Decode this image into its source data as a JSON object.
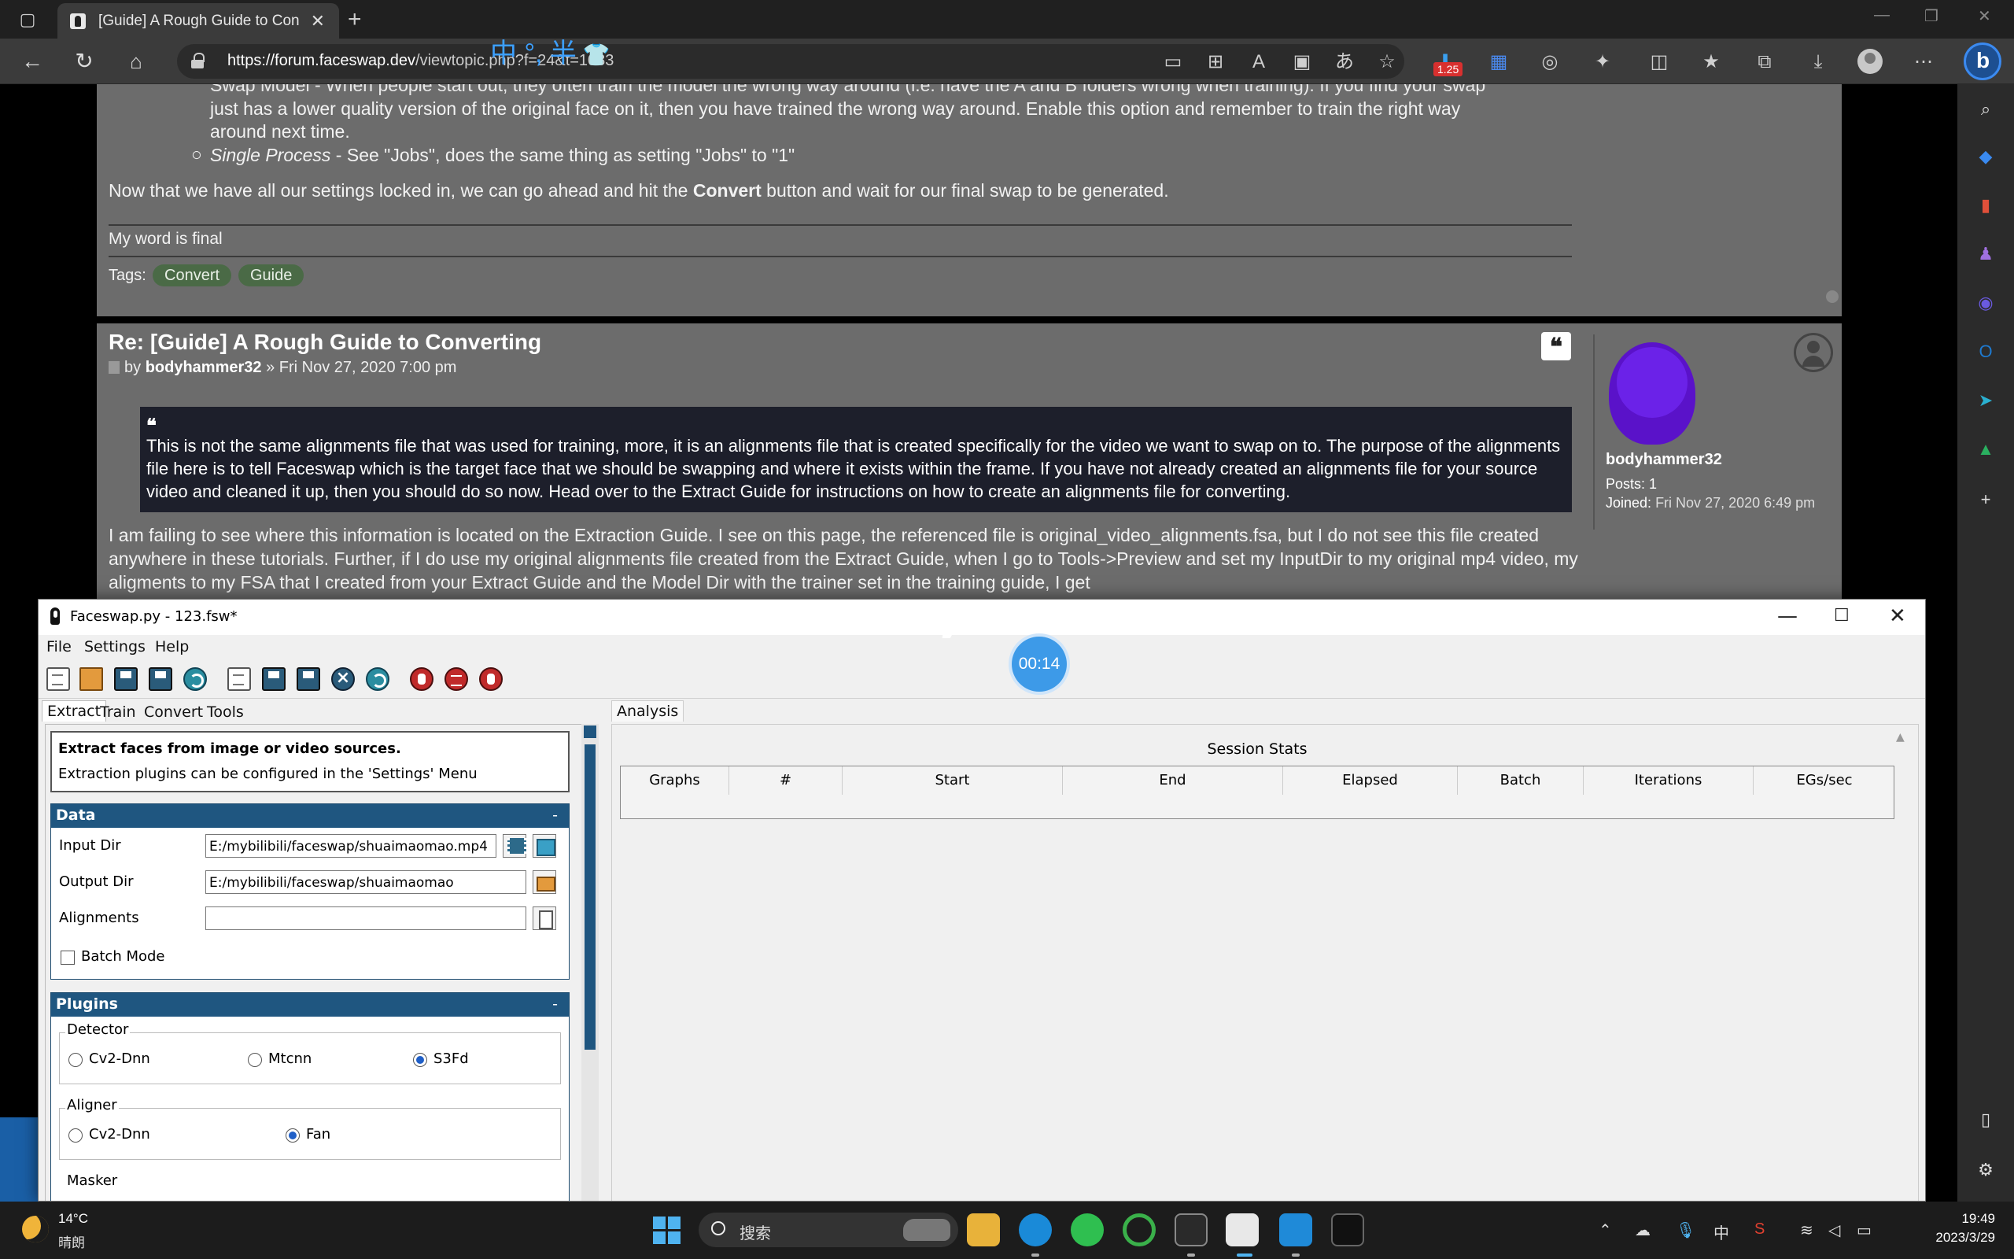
{
  "browser": {
    "tab_title": "[Guide] A Rough Guide to Converting",
    "url_host": "https://forum.faceswap.dev",
    "url_path": "/viewtopic.php?f=24&t=1083",
    "ime_overlay": "中 °, 半",
    "download_badge": "1.25"
  },
  "post1": {
    "line1": "Swap Model - When people start out, they often train the model the wrong way around (i.e. have the A and B folders wrong when training). If you find your swap",
    "line2": "just has a lower quality version of the original face on it, then you have trained the wrong way around. Enable this option and remember to train the right way",
    "line3": "around next time.",
    "single_process_label": "Single Process",
    "single_process_text": " - See \"Jobs\", does the same thing as setting \"Jobs\" to \"1\"",
    "final_pre": "Now that we have all our settings locked in, we can go ahead and hit the ",
    "final_bold": "Convert",
    "final_post": " button and wait for our final swap to be generated.",
    "signature": "My word is final",
    "tags_label": "Tags:",
    "tags": [
      "Convert",
      "Guide"
    ]
  },
  "post2": {
    "title": "Re: [Guide] A Rough Guide to Converting",
    "by": "by",
    "author": "bodyhammer32",
    "date": "» Fri Nov 27, 2020 7:00 pm",
    "quote_mark": "❝",
    "quote": "This is not the same alignments file that was used for training, more, it is an alignments file that is created specifically for the video we want to swap on to. The purpose of the alignments file here is to tell Faceswap which is the target face that we should be swapping and where it exists within the frame. If you have not already created an alignments file for your source video and cleaned it up, then you should do so now. Head over to the Extract Guide for instructions on how to create an alignments file for converting.",
    "body": "I am failing to see where this information is located on the Extraction Guide. I see on this page, the referenced file is original_video_alignments.fsa, but I do not see this file created anywhere in these tutorials. Further, if I do use my original alignments file created from the Extract Guide, when I go to Tools->Preview and set my InputDir to my original mp4 video, my aligments to my FSA that I created from your Extract Guide and the Model Dir with the trainer set in the training guide, I get",
    "profile_name": "bodyhammer32",
    "posts_label": "Posts:",
    "posts_value": "1",
    "joined_label": "Joined:",
    "joined_value": "Fri Nov 27, 2020 6:49 pm"
  },
  "faceswap": {
    "title": "Faceswap.py - 123.fsw*",
    "menu": [
      "File",
      "Settings",
      "Help"
    ],
    "tabs": [
      "Extract",
      "Train",
      "Convert",
      "Tools"
    ],
    "right_tab": "Analysis",
    "timer": "00:14",
    "info_title": "Extract faces from image or video sources.",
    "info_sub": "Extraction plugins can be configured in the 'Settings' Menu",
    "data_header": "Data",
    "input_dir_label": "Input Dir",
    "input_dir_value": "E:/mybilibili/faceswap/shuaimaomao.mp4",
    "output_dir_label": "Output Dir",
    "output_dir_value": "E:/mybilibili/faceswap/shuaimaomao",
    "alignments_label": "Alignments",
    "alignments_value": "",
    "batch_mode_label": "Batch Mode",
    "plugins_header": "Plugins",
    "detector_label": "Detector",
    "detector_options": [
      "Cv2-Dnn",
      "Mtcnn",
      "S3Fd"
    ],
    "detector_selected": "S3Fd",
    "aligner_label": "Aligner",
    "aligner_options": [
      "Cv2-Dnn",
      "Fan"
    ],
    "aligner_selected": "Fan",
    "masker_label": "Masker",
    "session_stats_title": "Session Stats",
    "stats_columns": [
      "Graphs",
      "#",
      "Start",
      "End",
      "Elapsed",
      "Batch",
      "Iterations",
      "EGs/sec"
    ]
  },
  "taskbar": {
    "temperature": "14°C",
    "weather": "晴朗",
    "search_placeholder": "搜索",
    "ime_lang": "中",
    "time": "19:49",
    "date": "2023/3/29"
  },
  "colors": {
    "forum_post_bg": "#6c6c6c",
    "quote_bg": "#1d1f2b",
    "tag_bg": "#4a6a46",
    "faceswap_section_header": "#1f5680",
    "avatar_purple": "#5a12c9"
  }
}
